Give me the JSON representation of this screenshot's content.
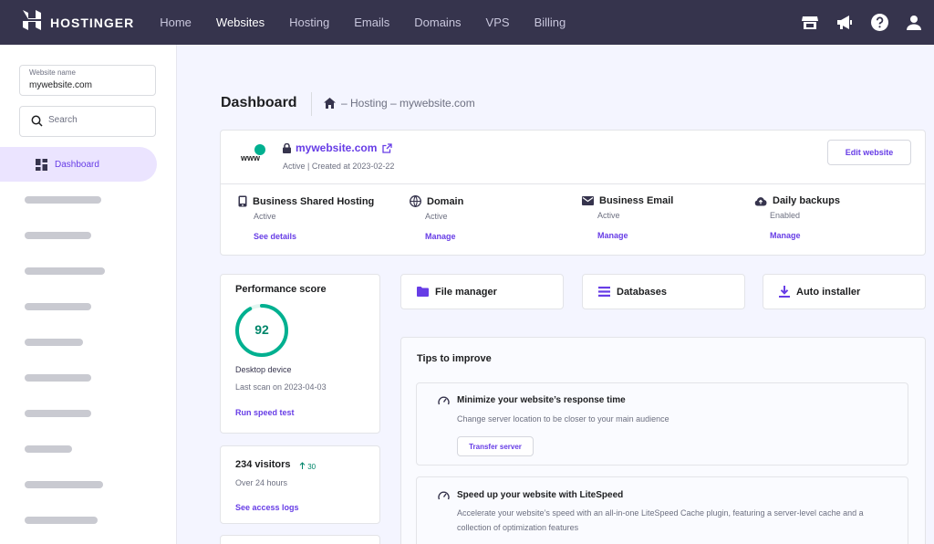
{
  "brand": {
    "name": "HOSTINGER",
    "logo_icon": "hostinger-logo-icon"
  },
  "nav": {
    "items": [
      {
        "label": "Home"
      },
      {
        "label": "Websites"
      },
      {
        "label": "Hosting"
      },
      {
        "label": "Emails"
      },
      {
        "label": "Domains"
      },
      {
        "label": "VPS"
      },
      {
        "label": "Billing"
      }
    ],
    "active": "Websites",
    "right_icons": [
      "store-icon",
      "megaphone-icon",
      "help-icon",
      "user-icon"
    ]
  },
  "sidebar": {
    "website_label": "Website name",
    "website_value": "mywebsite.com",
    "search_placeholder": "Search",
    "active_item": {
      "label": "Dashboard",
      "icon": "dashboard-icon"
    }
  },
  "header": {
    "title": "Dashboard",
    "breadcrumb": "– Hosting – mywebsite.com",
    "breadcrumb_icon": "home-icon"
  },
  "site": {
    "badge": "www",
    "name": "mywebsite.com",
    "status": "Active | Created at 2023-02-22",
    "edit_button": "Edit website",
    "services": [
      {
        "icon": "phone-icon",
        "name": "Business Shared Hosting",
        "status": "Active",
        "action": "See details"
      },
      {
        "icon": "globe-icon",
        "name": "Domain",
        "status": "Active",
        "action": "Manage"
      },
      {
        "icon": "mail-icon",
        "name": "Business Email",
        "status": "Active",
        "action": "Manage"
      },
      {
        "icon": "cloud-upload-icon",
        "name": "Daily backups",
        "status": "Enabled",
        "action": "Manage"
      }
    ]
  },
  "performance": {
    "title": "Performance score",
    "score": "92",
    "score_fraction": 0.92,
    "device": "Desktop device",
    "last_scan": "Last scan on 2023-04-03",
    "action": "Run speed test"
  },
  "visitors": {
    "title": "234 visitors",
    "trend": "30",
    "period": "Over 24 hours",
    "action": "See access logs"
  },
  "tools": [
    {
      "icon": "folder-icon",
      "label": "File manager"
    },
    {
      "icon": "database-icon",
      "label": "Databases"
    },
    {
      "icon": "download-icon",
      "label": "Auto installer"
    }
  ],
  "tips": {
    "title": "Tips to improve",
    "items": [
      {
        "icon": "speedometer-icon",
        "title": "Minimize your website’s response time",
        "text": "Change server location to be closer to your main audience",
        "button": "Transfer server"
      },
      {
        "icon": "speedometer-icon",
        "title": "Speed up your website with LiteSpeed",
        "text": "Accelerate your website’s speed with an all-in-one LiteSpeed Cache plugin, featuring a server-level cache and a collection of optimization features"
      }
    ]
  },
  "colors": {
    "nav_bg": "#36344d",
    "accent": "#673de6",
    "success": "#00b090",
    "page_bg": "#f4f5ff"
  }
}
